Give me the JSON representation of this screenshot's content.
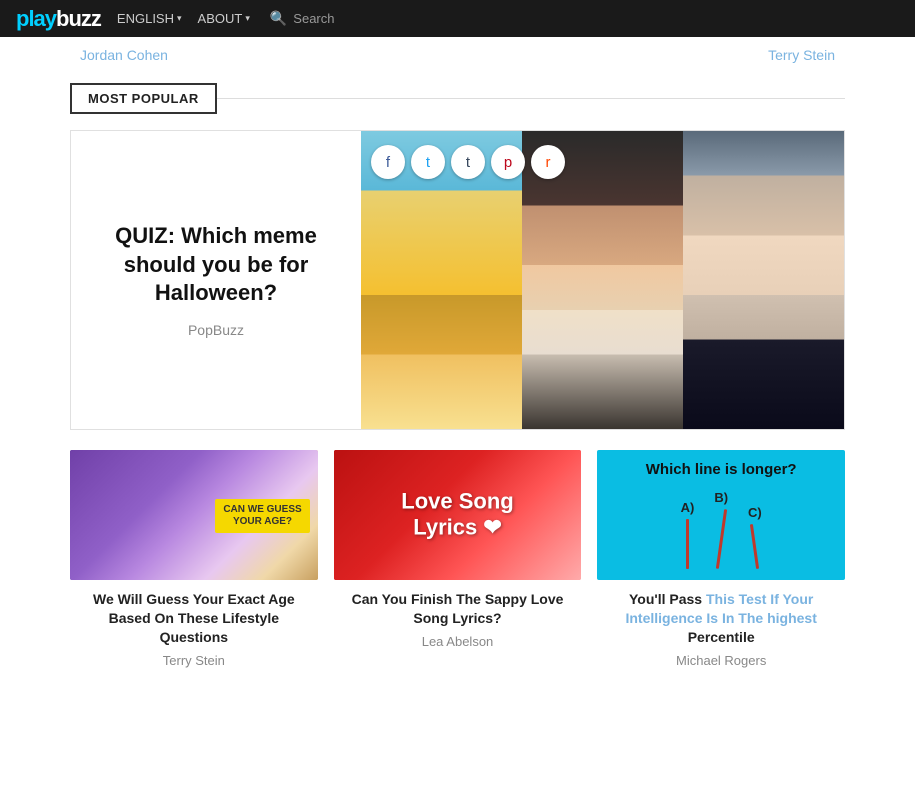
{
  "navbar": {
    "logo_text": "playbuzz",
    "links": [
      {
        "label": "ENGLISH",
        "has_dropdown": true
      },
      {
        "label": "ABOUT",
        "has_dropdown": true
      }
    ],
    "search_placeholder": "Search"
  },
  "top_authors": [
    {
      "name": "Jordan Cohen"
    },
    {
      "name": "Terry Stein"
    }
  ],
  "section": {
    "most_popular_label": "MOST POPULAR"
  },
  "featured": {
    "title": "QUIZ: Which meme should you be for Halloween?",
    "author": "PopBuzz"
  },
  "share": {
    "fb": "f",
    "tw": "t",
    "tm": "t",
    "pi": "p",
    "rd": "r"
  },
  "cards": [
    {
      "id": 1,
      "badge": "CAN WE GUESS YOUR AGE?",
      "title": "We Will Guess Your Exact Age Based On These Lifestyle Questions",
      "author": "Terry Stein"
    },
    {
      "id": 2,
      "overlay_line1": "Love Song",
      "overlay_line2": "Lyrics",
      "title": "Can You Finish The Sappy Love Song Lyrics?",
      "author": "Lea Abelson"
    },
    {
      "id": 3,
      "line_test_title": "Which line is longer?",
      "line_labels": [
        "A)",
        "B)",
        "C)"
      ],
      "line_heights": [
        50,
        60,
        45
      ],
      "title_part1": "You'll Pass ",
      "title_highlight": "This Test If Your Intelligence Is In The highest",
      "title_part2": " Percentile",
      "title_full": "You'll Pass This Test If Your Intelligence Is In The highest Percentile",
      "author": "Michael Rogers"
    }
  ]
}
